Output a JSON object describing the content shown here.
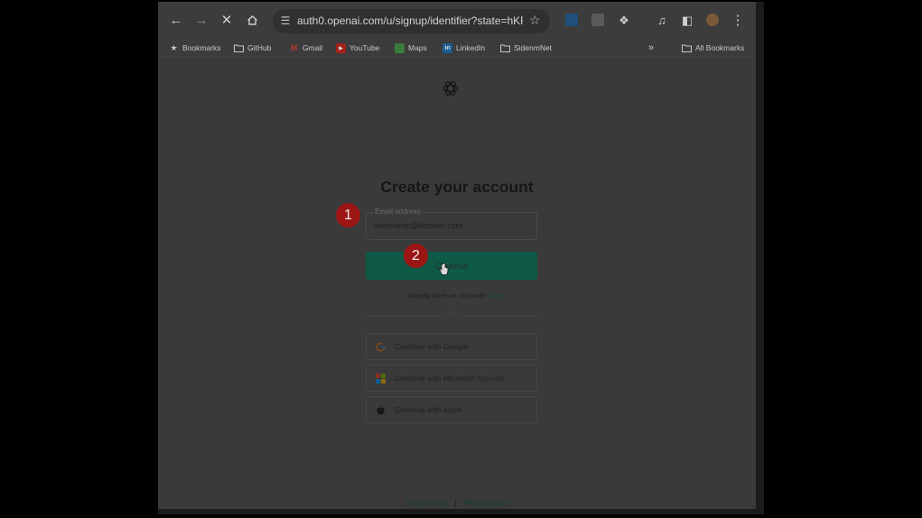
{
  "browser": {
    "url": "auth0.openai.com/u/signup/identifier?state=hKFo...",
    "bookmarks": [
      {
        "label": "Bookmarks",
        "icon": "star-icon"
      },
      {
        "label": "GitHub",
        "icon": "folder-icon"
      },
      {
        "label": "Gmail",
        "icon": "gmail-icon"
      },
      {
        "label": "YouTube",
        "icon": "youtube-icon"
      },
      {
        "label": "Maps",
        "icon": "maps-icon"
      },
      {
        "label": "LinkedIn",
        "icon": "linkedin-icon"
      },
      {
        "label": "SidenmNet",
        "icon": "folder-icon"
      }
    ],
    "all_bookmarks": "All Bookmarks"
  },
  "signup": {
    "title": "Create your account",
    "email_label": "Email address",
    "email_value": "username@domain.com",
    "continue_label": "Continue",
    "have_account": "Already have an account?",
    "login_label": "Log in",
    "or_label": "OR",
    "social": [
      {
        "label": "Continue with Google",
        "icon": "google-icon"
      },
      {
        "label": "Continue with Microsoft Account",
        "icon": "microsoft-icon"
      },
      {
        "label": "Continue with Apple",
        "icon": "apple-icon"
      }
    ]
  },
  "footer": {
    "terms": "Terms of use",
    "separator": "|",
    "privacy": "Privacy policy"
  },
  "annotations": {
    "step1": "1",
    "step2": "2"
  },
  "colors": {
    "accent": "#10a37f",
    "marker": "#c62828",
    "overlay": "dimmed"
  }
}
